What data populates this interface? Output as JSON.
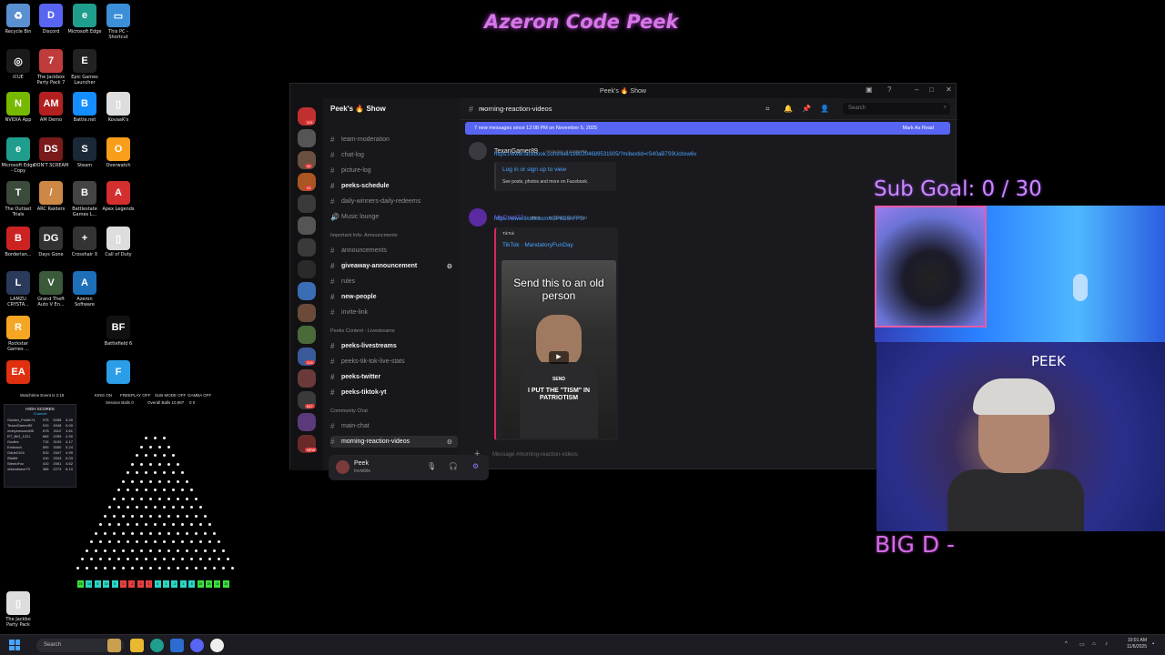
{
  "stream": {
    "title": "Azeron Code Peek",
    "sub_goal": "Sub Goal:  0 / 30",
    "cam_label": "PEEK",
    "ticker": "BIG D -"
  },
  "desktop": {
    "icons": [
      {
        "label": "Recycle Bin",
        "color": "#5a8fd0",
        "glyph": "♻"
      },
      {
        "label": "Discord",
        "color": "#5865f2",
        "glyph": "D"
      },
      {
        "label": "Microsoft Edge",
        "color": "#1f9e8e",
        "glyph": "e"
      },
      {
        "label": "This PC - Shortcut",
        "color": "#3b8fd9",
        "glyph": "▭"
      },
      {
        "label": "iCUE",
        "color": "#1a1a1a",
        "glyph": "◎"
      },
      {
        "label": "The Jackbox Party Pack 7",
        "color": "#c03c3c",
        "glyph": "7"
      },
      {
        "label": "Epic Games Launcher",
        "color": "#222",
        "glyph": "E"
      },
      {
        "label": "NVIDIA App",
        "color": "#76b900",
        "glyph": "N"
      },
      {
        "label": "AM Demo",
        "color": "#b32020",
        "glyph": "AM"
      },
      {
        "label": "Battle.net",
        "color": "#148eff",
        "glyph": "B"
      },
      {
        "label": "KovaaK's",
        "color": "#ddd",
        "glyph": "▯"
      },
      {
        "label": "Microsoft Edge - Copy",
        "color": "#1f9e8e",
        "glyph": "e"
      },
      {
        "label": "DON'T SCREAM",
        "color": "#7a1a1a",
        "glyph": "DS"
      },
      {
        "label": "Steam",
        "color": "#1b2838",
        "glyph": "S"
      },
      {
        "label": "Overwatch",
        "color": "#f99e1a",
        "glyph": "O"
      },
      {
        "label": "The Outlast Trials",
        "color": "#3b4a3b",
        "glyph": "T"
      },
      {
        "label": "ARC Raiders",
        "color": "#c84",
        "glyph": "/"
      },
      {
        "label": "Battlestate Games L...",
        "color": "#444",
        "glyph": "B"
      },
      {
        "label": "Apex Legends",
        "color": "#d32f2f",
        "glyph": "A"
      },
      {
        "label": "Borderlan...",
        "color": "#c22",
        "glyph": "B"
      },
      {
        "label": "Days Gone",
        "color": "#333",
        "glyph": "DG"
      },
      {
        "label": "Crosshair X",
        "color": "#333",
        "glyph": "+"
      },
      {
        "label": "Call of Duty",
        "color": "#ddd",
        "glyph": "▯"
      },
      {
        "label": "LAMZU CRYSTA...",
        "color": "#2a3a5a",
        "glyph": "L"
      },
      {
        "label": "Grand Theft Auto V En...",
        "color": "#3a5a3a",
        "glyph": "V"
      },
      {
        "label": "Azeron Software",
        "color": "#1c6fb8",
        "glyph": "A"
      },
      {
        "label": "Rockstar Games ...",
        "color": "#f5a623",
        "glyph": "R"
      },
      {
        "label": "Battlefield 6",
        "color": "#111",
        "glyph": "BF"
      },
      {
        "label": "",
        "color": "#e03010",
        "glyph": "EA"
      },
      {
        "label": "",
        "color": "#2a9ee8",
        "glyph": "F"
      },
      {
        "label": "The Jackbo Party Pack",
        "color": "#ddd",
        "glyph": "▯"
      }
    ]
  },
  "discord": {
    "window_title": "Peek's 🔥 Show",
    "server_name": "Peek's 🔥 Show",
    "channels": [
      {
        "name": "team-moderation",
        "type": "text",
        "state": "muted"
      },
      {
        "name": "chat-log",
        "type": "text",
        "state": "muted"
      },
      {
        "name": "picture-log",
        "type": "text",
        "state": "muted"
      },
      {
        "name": "peeks-schedule",
        "type": "text",
        "state": "unread"
      },
      {
        "name": "daily-winners-daily-redeems",
        "type": "text",
        "state": "muted"
      },
      {
        "name": "Music lounge",
        "type": "voice",
        "state": "muted"
      },
      {
        "name": "announcements",
        "type": "text",
        "state": "muted"
      },
      {
        "name": "giveaway-announcement",
        "type": "text",
        "state": "hover"
      },
      {
        "name": "rules",
        "type": "text",
        "state": "muted"
      },
      {
        "name": "new-people",
        "type": "text",
        "state": "unread"
      },
      {
        "name": "invite-link",
        "type": "text",
        "state": "muted"
      },
      {
        "name": "peeks-livestreams",
        "type": "text",
        "state": "unread"
      },
      {
        "name": "peeks-tik-tok-live-stats",
        "type": "text",
        "state": "muted"
      },
      {
        "name": "peeks-twitter",
        "type": "text",
        "state": "unread"
      },
      {
        "name": "peeks-tiktok-yt",
        "type": "text",
        "state": "unread"
      },
      {
        "name": "main-chat",
        "type": "text",
        "state": "muted"
      },
      {
        "name": "morning-reaction-videos",
        "type": "text",
        "state": "active"
      }
    ],
    "categories": [
      "Important Info- Announcments",
      "Peeks Content - Livestreams",
      "Community Chat"
    ],
    "user": {
      "name": "Peek",
      "status": "Invisible"
    },
    "guild_badges": [
      "101",
      "40",
      "93",
      "226",
      "847",
      "NEW"
    ],
    "chat": {
      "channel": "morning-reaction-videos",
      "search_placeholder": "Search",
      "new_messages_banner": "7 new messages since 12:08 PM on November 5, 2025",
      "mark_as_read": "Mark As Read",
      "messages": [
        {
          "author": "TexanGamer89",
          "time": "Yesterday at 12:08 PM",
          "link": "https://www.facebook.com/reel/1880304689531905/?mibextid=rS40aB7S9Ucbxw6v",
          "embed_title": "Log in or sign up to view",
          "embed_desc": "See posts, photos and more on Facebook."
        },
        {
          "author": "McGoat23",
          "tag": "PGG",
          "time": "Yesterday at 4:43 PM",
          "link": "https://www.tiktok.com/t/ZP8D5hFFS/",
          "embed_provider": "TikTok",
          "embed_title": "TikTok · MandatoryFunDay",
          "video_caption": "Send this to an old person",
          "shirt_text": "SEND",
          "shirt_text2": "I PUT THE \"TISM\" IN PATRIOTISM"
        }
      ],
      "composer_placeholder": "Message #morning-reaction-videos"
    }
  },
  "plinko": {
    "header_left": "Watchtime Event is 2:18",
    "header_right": [
      "KING ON",
      "FREEPLAY OFF",
      "SUB MODE OFF",
      "GAMBA OFF"
    ],
    "session_balls": "Session Balls 0",
    "overall_balls": "Overall Balls 10,987",
    "overall_extra": "0 0",
    "highscores_title": "HIGH SCORES",
    "highscores_sub": "Channel",
    "rows": [
      [
        "Golden_Fiddle74",
        "975",
        "5268",
        "5.40"
      ],
      [
        "TexanGamer89",
        "910",
        "4548",
        "5.00"
      ],
      [
        "mobysmoacci08",
        "675",
        "3112",
        "4.61"
      ],
      [
        "RT_BIG_1221",
        "665",
        "2259",
        "4.90"
      ],
      [
        "Godlec",
        "715",
        "3104",
        "4.17"
      ],
      [
        "Krinbach",
        "590",
        "3050",
        "5.24"
      ],
      [
        "Gdub2104",
        "510",
        "2547",
        "4.99"
      ],
      [
        "iSkillitt",
        "410",
        "2533",
        "6.03"
      ],
      [
        "StentoFox",
        "410",
        "2061",
        "4.62"
      ],
      [
        "oldandsave73",
        "385",
        "2274",
        "6.10"
      ]
    ],
    "slots": [
      "25",
      "10",
      "5",
      "10",
      "5",
      "1",
      "-2",
      "-1",
      "1",
      "5",
      "1",
      "-2",
      "1",
      "5",
      "10",
      "25",
      "10",
      "25"
    ]
  },
  "taskbar": {
    "search": "Search",
    "time": "10:01 AM",
    "date": "11/6/2025"
  },
  "colors": {
    "discord_blurple": "#5865f2",
    "title_purple": "#d776e9",
    "sub_goal": "#c889ff"
  }
}
